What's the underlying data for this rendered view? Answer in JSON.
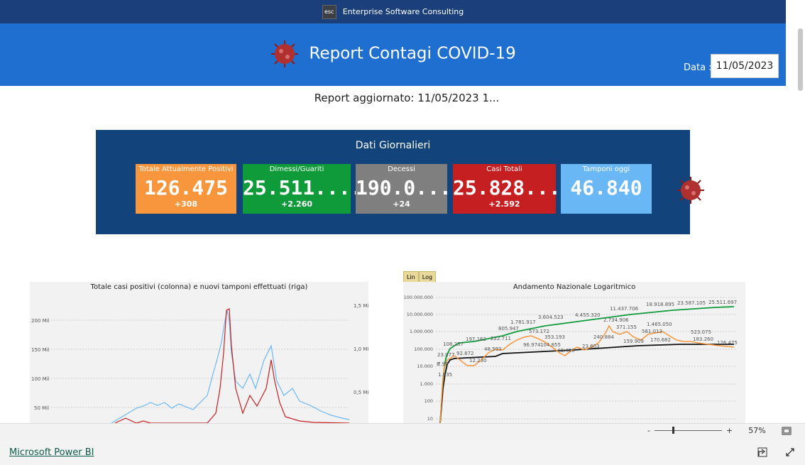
{
  "topbar": {
    "logo_text": "esc",
    "company": "Enterprise Software Consulting"
  },
  "header": {
    "title": "Report Contagi COVID-19",
    "date_label": "Data :",
    "date_value": "11/05/2023"
  },
  "subtitle": "Report aggiornato: 11/05/2023 1...",
  "daily": {
    "title": "Dati Giornalieri",
    "cards": [
      {
        "label": "Totale Attualmente Positivi",
        "value": "126.475",
        "delta": "+308",
        "color": "#f7963c"
      },
      {
        "label": "Dimessi/Guariti",
        "value": "25.511....",
        "delta": "+2.260",
        "color": "#0f9b3a"
      },
      {
        "label": "Decessi",
        "value": "190.0...",
        "delta": "+24",
        "color": "#7f7f7f"
      },
      {
        "label": "Casi Totali",
        "value": "25.828...",
        "delta": "+2.592",
        "color": "#c61f22"
      },
      {
        "label": "Tamponi oggi",
        "value": "46.840",
        "delta": "",
        "color": "#6ab7f5"
      }
    ]
  },
  "chart_left": {
    "title": "Totale casi positivi (colonna) e nuovi tamponi effettuati (riga)",
    "y_left_ticks": [
      "200 Mil",
      "150 Mil",
      "100 Mil",
      "50 Mil"
    ],
    "y_right_ticks": [
      "1,5 Mi",
      "1,0 Mi",
      "0,5 Mi"
    ]
  },
  "chart_right": {
    "title": "Andamento Nazionale Logaritmico",
    "toggle": [
      "Lin",
      "Log"
    ],
    "y_ticks": [
      "100.000.000",
      "10.000.000",
      "1.000.000",
      "100.000",
      "10.000",
      "1.000",
      "100",
      "10"
    ],
    "labels_green": [
      "23.077",
      "108.257",
      "197.162",
      "222.711",
      "805.947",
      "1.781.917",
      "3.604.523",
      "4.455.320",
      "11.437.706",
      "18.918.895",
      "23.587.105",
      "25.511.697"
    ],
    "labels_orange": [
      "8",
      "7.98",
      "1.835",
      "92.872",
      "12.230",
      "48.593",
      "96.974",
      "573.172",
      "353.193",
      "104.855",
      "40.426",
      "23.603",
      "240.884",
      "2.734.906",
      "371.155",
      "561.013",
      "1.465.050",
      "159.909",
      "170.682",
      "523.075",
      "183.260",
      "126.475"
    ]
  },
  "bottom": {
    "zoom_minus": "-",
    "zoom_plus": "+",
    "zoom": "57%"
  },
  "footer": {
    "link": "Microsoft Power BI"
  }
}
